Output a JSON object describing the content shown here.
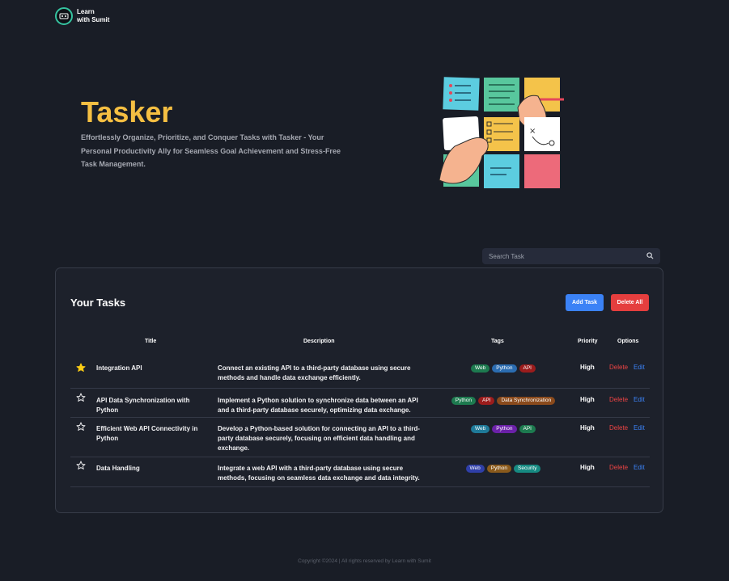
{
  "brand": {
    "line1": "Learn",
    "line2": "with Sumit"
  },
  "hero": {
    "title": "Tasker",
    "subtitle": "Effortlessly Organize, Prioritize, and Conquer Tasks with Tasker - Your Personal Productivity Ally for Seamless Goal Achievement and Stress-Free Task Management."
  },
  "search": {
    "placeholder": "Search Task"
  },
  "tasks": {
    "heading": "Your Tasks",
    "add_label": "Add Task",
    "delete_all_label": "Delete All",
    "columns": {
      "title": "Title",
      "description": "Description",
      "tags": "Tags",
      "priority": "Priority",
      "options": "Options"
    },
    "rows": [
      {
        "favorite": true,
        "title": "Integration API",
        "description": "Connect an existing API to a third-party database using secure methods and handle data exchange efficiently.",
        "tags": [
          {
            "label": "Web",
            "color": "#1d7a4f"
          },
          {
            "label": "Python",
            "color": "#2b6cb0"
          },
          {
            "label": "API",
            "color": "#9b1c1c"
          }
        ],
        "priority": "High",
        "delete_label": "Delete",
        "edit_label": "Edit"
      },
      {
        "favorite": false,
        "title": "API Data Synchronization with Python",
        "description": "Implement a Python solution to synchronize data between an API and a third-party database securely, optimizing data exchange.",
        "tags": [
          {
            "label": "Python",
            "color": "#1d7a4f"
          },
          {
            "label": "API",
            "color": "#9b1c1c"
          },
          {
            "label": "Data Synchronization",
            "color": "#8a4a1c"
          }
        ],
        "priority": "High",
        "delete_label": "Delete",
        "edit_label": "Edit"
      },
      {
        "favorite": false,
        "title": "Efficient Web API Connectivity in Python",
        "description": "Develop a Python-based solution for connecting an API to a third-party database securely, focusing on efficient data handling and exchange.",
        "tags": [
          {
            "label": "Web",
            "color": "#1f7a99"
          },
          {
            "label": "Python",
            "color": "#6b21a8"
          },
          {
            "label": "API",
            "color": "#1d7a4f"
          }
        ],
        "priority": "High",
        "delete_label": "Delete",
        "edit_label": "Edit"
      },
      {
        "favorite": false,
        "title": "Data Handling",
        "description": "Integrate a web API with a third-party database using secure methods, focusing on seamless data exchange and data integrity.",
        "tags": [
          {
            "label": "Web",
            "color": "#2f3fa8"
          },
          {
            "label": "Python",
            "color": "#8a5a1c"
          },
          {
            "label": "Security",
            "color": "#168a82"
          }
        ],
        "priority": "High",
        "delete_label": "Delete",
        "edit_label": "Edit"
      }
    ]
  },
  "footer": {
    "text": "Copyright ©2024 | All rights reserved by Learn with Sumit"
  }
}
